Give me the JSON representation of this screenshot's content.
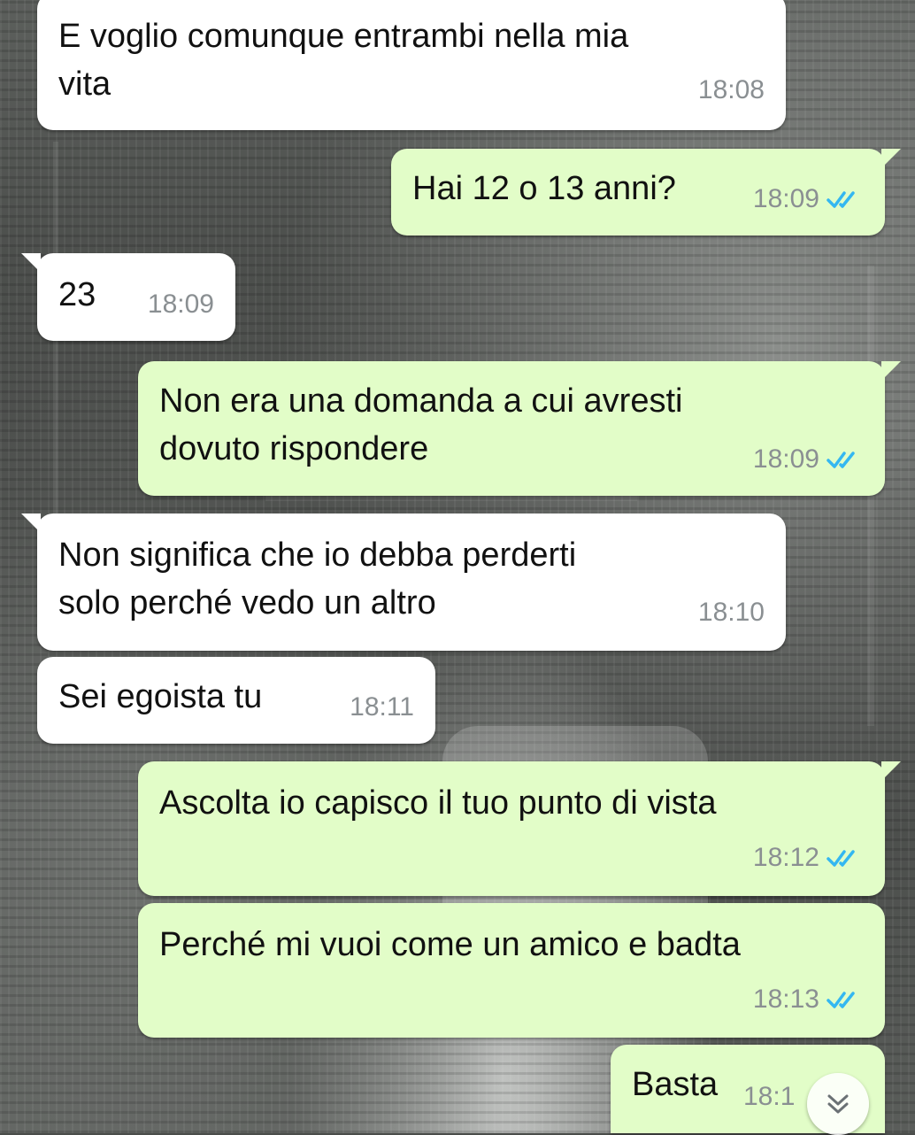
{
  "messages": [
    {
      "direction": "in",
      "text": "E voglio comunque entrambi nella mia\nvita",
      "time": "18:08"
    },
    {
      "direction": "out",
      "text": "Hai 12 o 13 anni?",
      "time": "18:09",
      "status": "read"
    },
    {
      "direction": "in",
      "text": "23",
      "time": "18:09"
    },
    {
      "direction": "out",
      "text": "Non era una domanda a cui avresti\ndovuto rispondere",
      "time": "18:09",
      "status": "read"
    },
    {
      "direction": "in",
      "text": "Non significa che io debba perderti\nsolo perché vedo un altro",
      "time": "18:10"
    },
    {
      "direction": "in",
      "text": "Sei egoista tu",
      "time": "18:11"
    },
    {
      "direction": "out",
      "text": "Ascolta io capisco il tuo punto di vista",
      "time": "18:12",
      "status": "read"
    },
    {
      "direction": "out",
      "text": "Perché mi vuoi come un amico e badta",
      "time": "18:13",
      "status": "read"
    },
    {
      "direction": "out",
      "text": "Basta",
      "time": "18:1",
      "status": "read"
    }
  ],
  "colors": {
    "incoming_bubble": "#ffffff",
    "outgoing_bubble": "#e2fdc8",
    "read_ticks": "#34b7f1",
    "timestamp": "#8a8f92"
  },
  "icons": {
    "read_receipt": "double-check-icon",
    "scroll_down": "chevron-double-down-icon"
  }
}
